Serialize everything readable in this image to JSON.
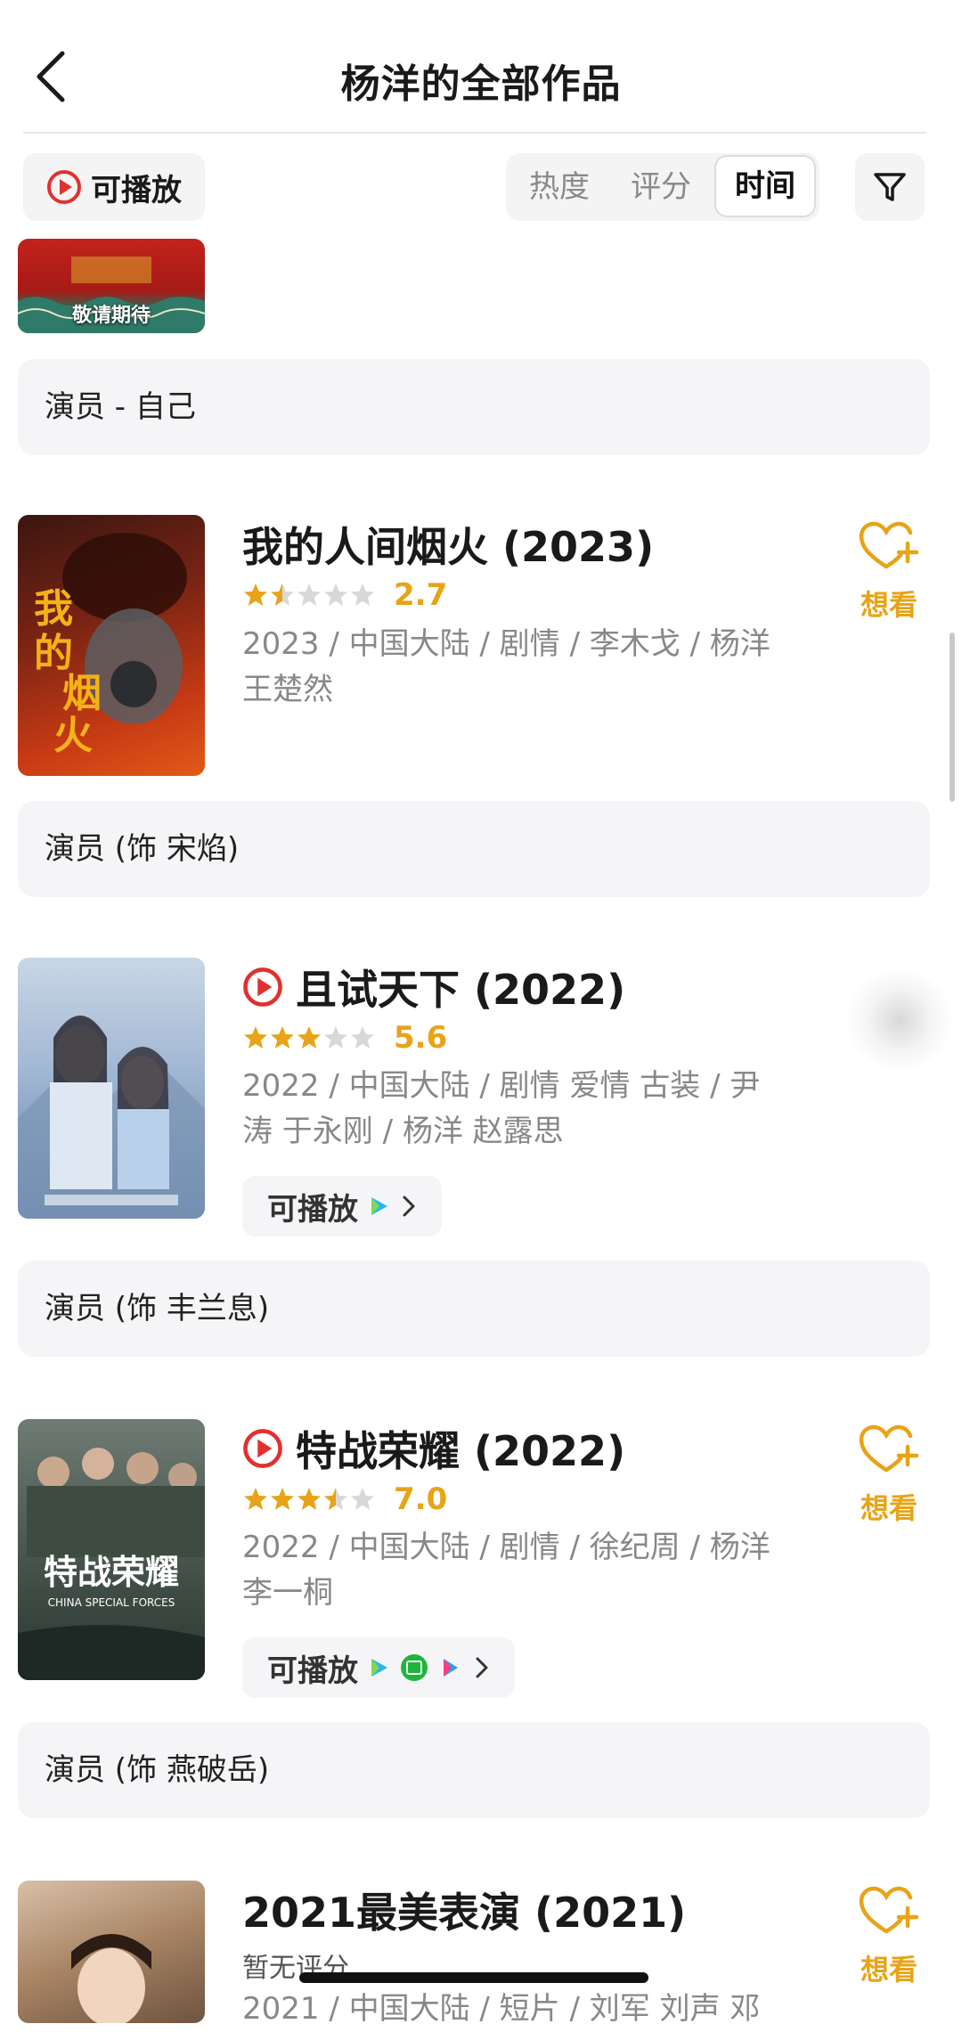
{
  "header": {
    "title": "杨洋的全部作品"
  },
  "filters": {
    "playable_label": "可播放",
    "sort_options": [
      "热度",
      "评分",
      "时间"
    ],
    "active_sort": "时间"
  },
  "top_card": {
    "poster_caption": "敬请期待",
    "role": "演员 - 自己"
  },
  "works": [
    {
      "title": "我的人间烟火 (2023)",
      "has_play_icon": false,
      "rating_stars": 1.5,
      "score": "2.7",
      "meta": "2023 / 中国大陆 / 剧情 / 李木戈 / 杨洋 王楚然",
      "want_label": "想看",
      "role": "演员 (饰 宋焰)"
    },
    {
      "title": "且试天下 (2022)",
      "has_play_icon": true,
      "rating_stars": 3,
      "score": "5.6",
      "meta": "2022 / 中国大陆 / 剧情 爱情 古装 / 尹涛 于永刚 / 杨洋 赵露思",
      "playable_label": "可播放",
      "role": "演员 (饰 丰兰息)"
    },
    {
      "title": "特战荣耀 (2022)",
      "has_play_icon": true,
      "rating_stars": 3.5,
      "score": "7.0",
      "meta": "2022 / 中国大陆 / 剧情 / 徐纪周 / 杨洋 李一桐",
      "playable_label": "可播放",
      "want_label": "想看",
      "role": "演员 (饰 燕破岳)"
    },
    {
      "title": "2021最美表演 (2021)",
      "has_play_icon": false,
      "no_rating": "暂无评分",
      "meta": "2021 / 中国大陆 / 短片 / 刘军 刘声 邓",
      "want_label": "想看"
    }
  ],
  "colors": {
    "accent": "#e8a317",
    "play_red": "#e0312f",
    "chip_bg": "#f5f5f7"
  }
}
